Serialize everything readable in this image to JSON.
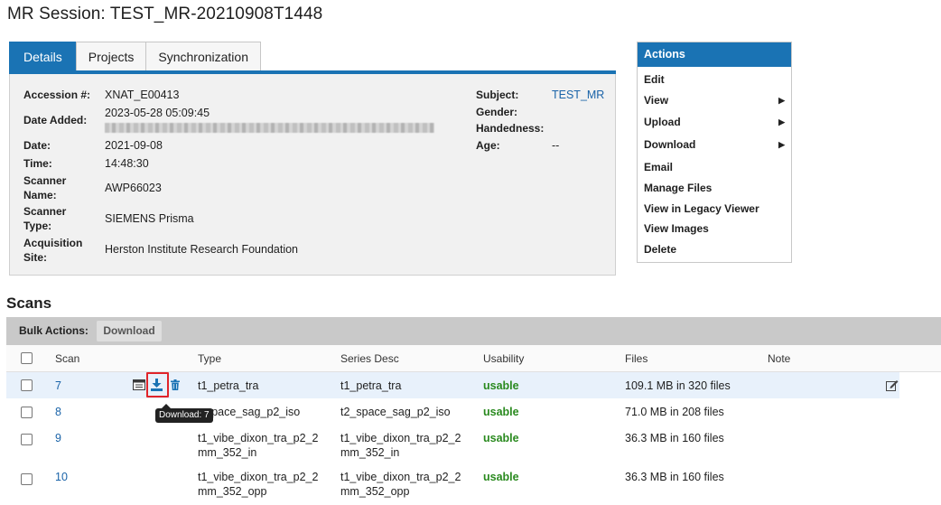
{
  "page": {
    "title": "MR Session: TEST_MR-20210908T1448"
  },
  "tabs": [
    {
      "label": "Details",
      "active": true
    },
    {
      "label": "Projects",
      "active": false
    },
    {
      "label": "Synchronization",
      "active": false
    }
  ],
  "details": {
    "accession_label": "Accession #:",
    "accession_value": "XNAT_E00413",
    "date_added_label": "Date Added:",
    "date_added_value": "2023-05-28 05:09:45",
    "date_label": "Date:",
    "date_value": "2021-09-08",
    "time_label": "Time:",
    "time_value": "14:48:30",
    "scanner_name_label_1": "Scanner",
    "scanner_name_label_2": "Name:",
    "scanner_name_value": "AWP66023",
    "scanner_type_label_1": "Scanner",
    "scanner_type_label_2": "Type:",
    "scanner_type_value": "SIEMENS Prisma",
    "acquisition_site_label_1": "Acquisition",
    "acquisition_site_label_2": "Site:",
    "acquisition_site_value": "Herston Institute Research Foundation",
    "subject_label": "Subject:",
    "subject_value": "TEST_MR",
    "gender_label": "Gender:",
    "handedness_label": "Handedness:",
    "age_label": "Age:",
    "age_value": "--"
  },
  "actions": {
    "title": "Actions",
    "items": [
      {
        "label": "Edit",
        "submenu": false
      },
      {
        "label": "View",
        "submenu": true
      },
      {
        "label": "Upload",
        "submenu": true
      },
      {
        "label": "Download",
        "submenu": true
      },
      {
        "label": "Email",
        "submenu": false
      },
      {
        "label": "Manage Files",
        "submenu": false
      },
      {
        "label": "View in Legacy Viewer",
        "submenu": false
      },
      {
        "label": "View Images",
        "submenu": false
      },
      {
        "label": "Delete",
        "submenu": false
      }
    ],
    "caret": "▶"
  },
  "scans": {
    "title": "Scans",
    "bulk_actions_label": "Bulk Actions:",
    "bulk_download_label": "Download",
    "columns": {
      "scan": "Scan",
      "type": "Type",
      "series_desc": "Series Desc",
      "usability": "Usability",
      "files": "Files",
      "note": "Note"
    },
    "rows": [
      {
        "scan": "7",
        "type_1": "t1_petra_tra",
        "type_2": "",
        "desc_1": "t1_petra_tra",
        "desc_2": "",
        "usability": "usable",
        "files": "109.1 MB in 320 files"
      },
      {
        "scan": "8",
        "type_1": "_space_sag_p2_iso",
        "type_2": "",
        "desc_1": "t2_space_sag_p2_iso",
        "desc_2": "",
        "usability": "usable",
        "files": "71.0 MB in 208 files"
      },
      {
        "scan": "9",
        "type_1": "t1_vibe_dixon_tra_p2_2",
        "type_2": "mm_352_in",
        "desc_1": "t1_vibe_dixon_tra_p2_2",
        "desc_2": "mm_352_in",
        "usability": "usable",
        "files": "36.3 MB in 160 files"
      },
      {
        "scan": "10",
        "type_1": "t1_vibe_dixon_tra_p2_2",
        "type_2": "mm_352_opp",
        "desc_1": "t1_vibe_dixon_tra_p2_2",
        "desc_2": "mm_352_opp",
        "usability": "usable",
        "files": "36.3 MB in 160 files"
      }
    ],
    "tooltip": "Download: 7"
  },
  "colors": {
    "accent": "#1a73b4",
    "link": "#1a63a8",
    "usable": "#2a8a1f",
    "highlight_row": "#e8f1fb",
    "focus_outline": "#e0242a"
  },
  "icons": {
    "details_icon": "details-icon",
    "download_icon": "download-icon",
    "delete_icon": "trash-icon",
    "edit_note_icon": "edit-note-icon"
  }
}
